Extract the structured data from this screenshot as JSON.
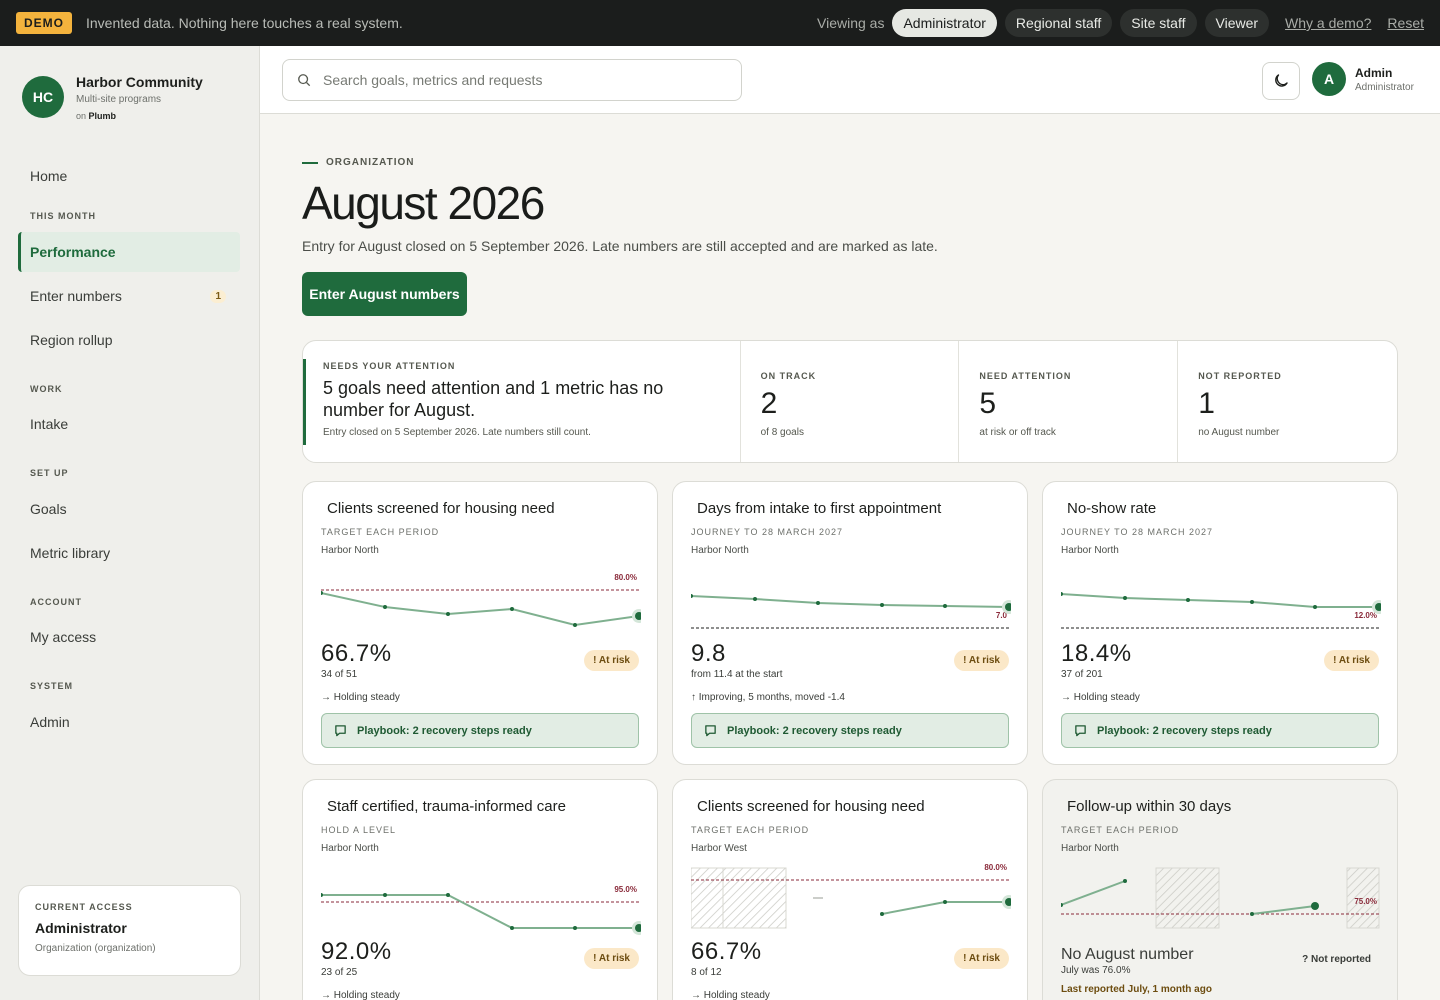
{
  "demo_bar": {
    "badge": "DEMO",
    "message": "Invented data. Nothing here touches a real system.",
    "viewing_as_label": "Viewing as",
    "roles": [
      "Administrator",
      "Regional staff",
      "Site staff",
      "Viewer"
    ],
    "active_role": "Administrator",
    "why_link": "Why a demo?",
    "reset_link": "Reset"
  },
  "org": {
    "initials": "HC",
    "name": "Harbor Community",
    "subtitle": "Multi-site programs",
    "on_prefix": "on",
    "platform": "Plumb"
  },
  "sidebar": {
    "home": "Home",
    "section_this_month": "THIS MONTH",
    "performance": "Performance",
    "enter_numbers": "Enter numbers",
    "enter_numbers_count": "1",
    "region_rollup": "Region rollup",
    "section_work": "WORK",
    "intake": "Intake",
    "section_set_up": "SET UP",
    "goals": "Goals",
    "metric_library": "Metric library",
    "section_account": "ACCOUNT",
    "my_access": "My access",
    "section_system": "SYSTEM",
    "admin": "Admin"
  },
  "current_access": {
    "label": "CURRENT ACCESS",
    "role": "Administrator",
    "scope": "Organization (organization)"
  },
  "header": {
    "search_placeholder": "Search goals, metrics and requests",
    "user_initial": "A",
    "user_name": "Admin",
    "user_role": "Administrator"
  },
  "page": {
    "eyebrow": "ORGANIZATION",
    "title": "August 2026",
    "subtitle": "Entry for August closed on 5 September 2026. Late numbers are still accepted and are marked as late.",
    "primary_button": "Enter August numbers"
  },
  "summary": {
    "attention_label": "NEEDS YOUR ATTENTION",
    "attention_text": "5 goals need attention and 1 metric has no number for August.",
    "attention_foot": "Entry closed on 5 September 2026. Late numbers still count.",
    "stats": [
      {
        "label": "ON TRACK",
        "value": "2",
        "caption": "of 8 goals"
      },
      {
        "label": "NEED ATTENTION",
        "value": "5",
        "caption": "at risk or off track"
      },
      {
        "label": "NOT REPORTED",
        "value": "1",
        "caption": "no August number"
      }
    ]
  },
  "cards": [
    {
      "title": "Clients screened for housing need",
      "eyebrow": "TARGET EACH PERIOD",
      "site": "Harbor North",
      "target_label": "80.0%",
      "value": "66.7%",
      "value_sub": "34 of 51",
      "trend": "→ Holding steady",
      "status": "! At risk",
      "playbook": "Playbook: 2 recovery steps ready"
    },
    {
      "title": "Days from intake to first appointment",
      "eyebrow": "JOURNEY TO 28 MARCH 2027",
      "site": "Harbor North",
      "target_label": "7.0",
      "value": "9.8",
      "value_sub": "from 11.4 at the start",
      "trend": "↑ Improving, 5 months, moved -1.4",
      "status": "! At risk",
      "playbook": "Playbook: 2 recovery steps ready"
    },
    {
      "title": "No-show rate",
      "eyebrow": "JOURNEY TO 28 MARCH 2027",
      "site": "Harbor North",
      "target_label": "12.0%",
      "value": "18.4%",
      "value_sub": "37 of 201",
      "trend": "→ Holding steady",
      "status": "! At risk",
      "playbook": "Playbook: 2 recovery steps ready"
    },
    {
      "title": "Staff certified, trauma-informed care",
      "eyebrow": "HOLD A LEVEL",
      "site": "Harbor North",
      "target_label": "95.0%",
      "value": "92.0%",
      "value_sub": "23 of 25",
      "trend": "→ Holding steady",
      "status": "! At risk"
    },
    {
      "title": "Clients screened for housing need",
      "eyebrow": "TARGET EACH PERIOD",
      "site": "Harbor West",
      "target_label": "80.0%",
      "value": "66.7%",
      "value_sub": "8 of 12",
      "trend": "→ Holding steady",
      "status": "! At risk"
    },
    {
      "title": "Follow-up within 30 days",
      "eyebrow": "TARGET EACH PERIOD",
      "site": "Harbor North",
      "target_label": "75.0%",
      "value": "No August number",
      "value_sub": "July was 76.0%",
      "last_reported": "Last reported July, 1 month ago",
      "status": "? Not reported"
    }
  ],
  "colors": {
    "accent": "#1f6b3d",
    "series_line": "#7fb08f",
    "target_line": "#8a2a3a",
    "at_risk_bg": "#fbe8c8"
  },
  "icons": [
    "search-icon",
    "moon-icon",
    "chat-icon"
  ]
}
